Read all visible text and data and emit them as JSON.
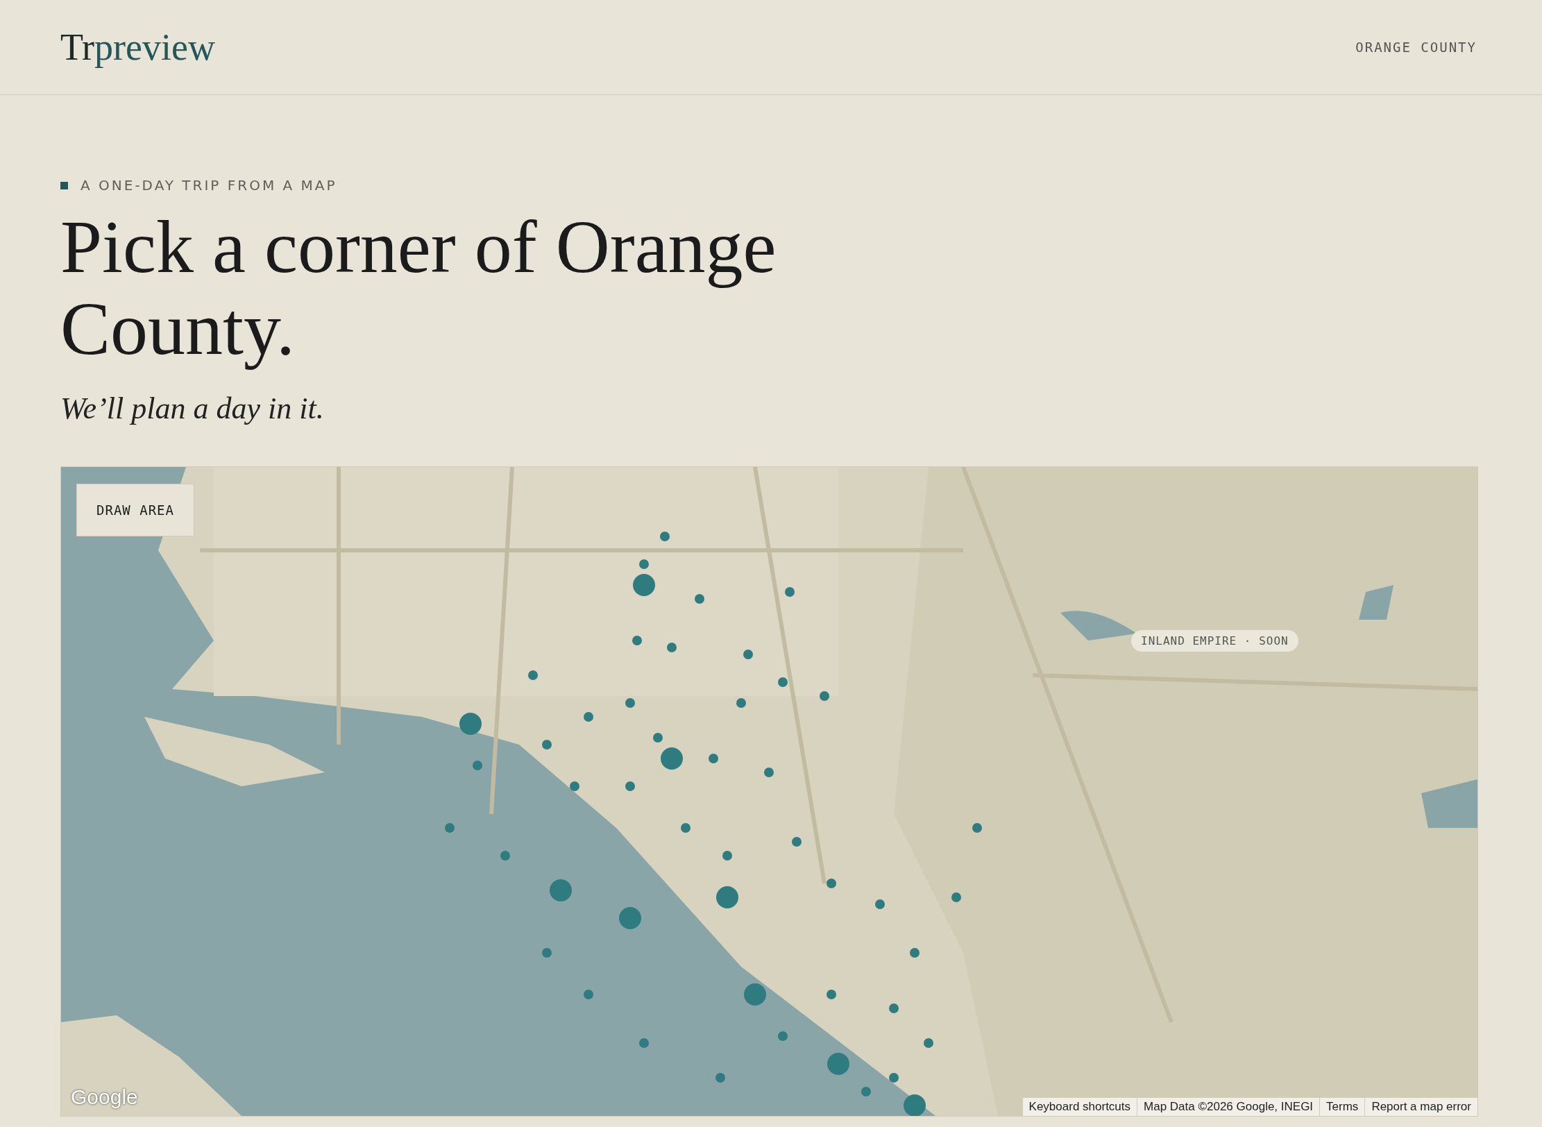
{
  "header": {
    "logo": {
      "lead": "Tr",
      "accent": "preview"
    },
    "region": "ORANGE COUNTY"
  },
  "hero": {
    "eyebrow": "A ONE-DAY TRIP FROM A MAP",
    "title": "Pick a corner of Orange County.",
    "subtitle": "We’ll plan a day in it."
  },
  "map": {
    "draw_button": "DRAW AREA",
    "region_badge": "INLAND EMPIRE · SOON",
    "provider_logo": "Google",
    "attribution": [
      "Keyboard shortcuts",
      "Map Data ©2026 Google, INEGI",
      "Terms",
      "Report a map error"
    ]
  }
}
